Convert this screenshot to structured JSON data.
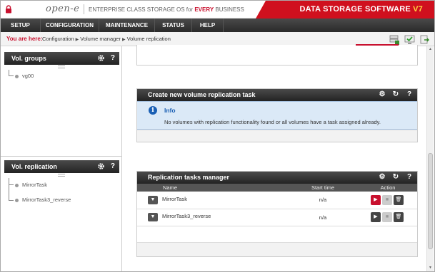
{
  "header": {
    "logo": "open-e",
    "tagline_prefix": "ENTERPRISE CLASS STORAGE OS for ",
    "tagline_highlight": "EVERY",
    "tagline_suffix": " BUSINESS",
    "brand": "DATA STORAGE SOFTWARE ",
    "version": "V7",
    "accent_color": "#d0101e"
  },
  "nav": {
    "items": [
      "SETUP",
      "CONFIGURATION",
      "MAINTENANCE",
      "STATUS",
      "HELP"
    ]
  },
  "breadcrumb": {
    "label": "You are here:",
    "parts": [
      "Configuration",
      "Volume manager",
      "Volume replication"
    ]
  },
  "vol_groups": {
    "title": "Vol. groups",
    "help": "?",
    "items": [
      "vg00"
    ]
  },
  "vol_replication": {
    "title": "Vol. replication",
    "help": "?",
    "items": [
      "MirrorTask",
      "MirrorTask3_reverse"
    ]
  },
  "create_task": {
    "title": "Create new volume replication task",
    "help": "?",
    "info_title": "Info",
    "info_icon": "i",
    "info_message": "No volumes with replication functionality found or all volumes have a task assigned already."
  },
  "tasks_manager": {
    "title": "Replication tasks manager",
    "help": "?",
    "columns": [
      "Name",
      "Start time",
      "Action"
    ],
    "rows": [
      {
        "name": "MirrorTask",
        "start_time": "n/a",
        "play_state": "active"
      },
      {
        "name": "MirrorTask3_reverse",
        "start_time": "n/a",
        "play_state": "inactive"
      }
    ]
  }
}
